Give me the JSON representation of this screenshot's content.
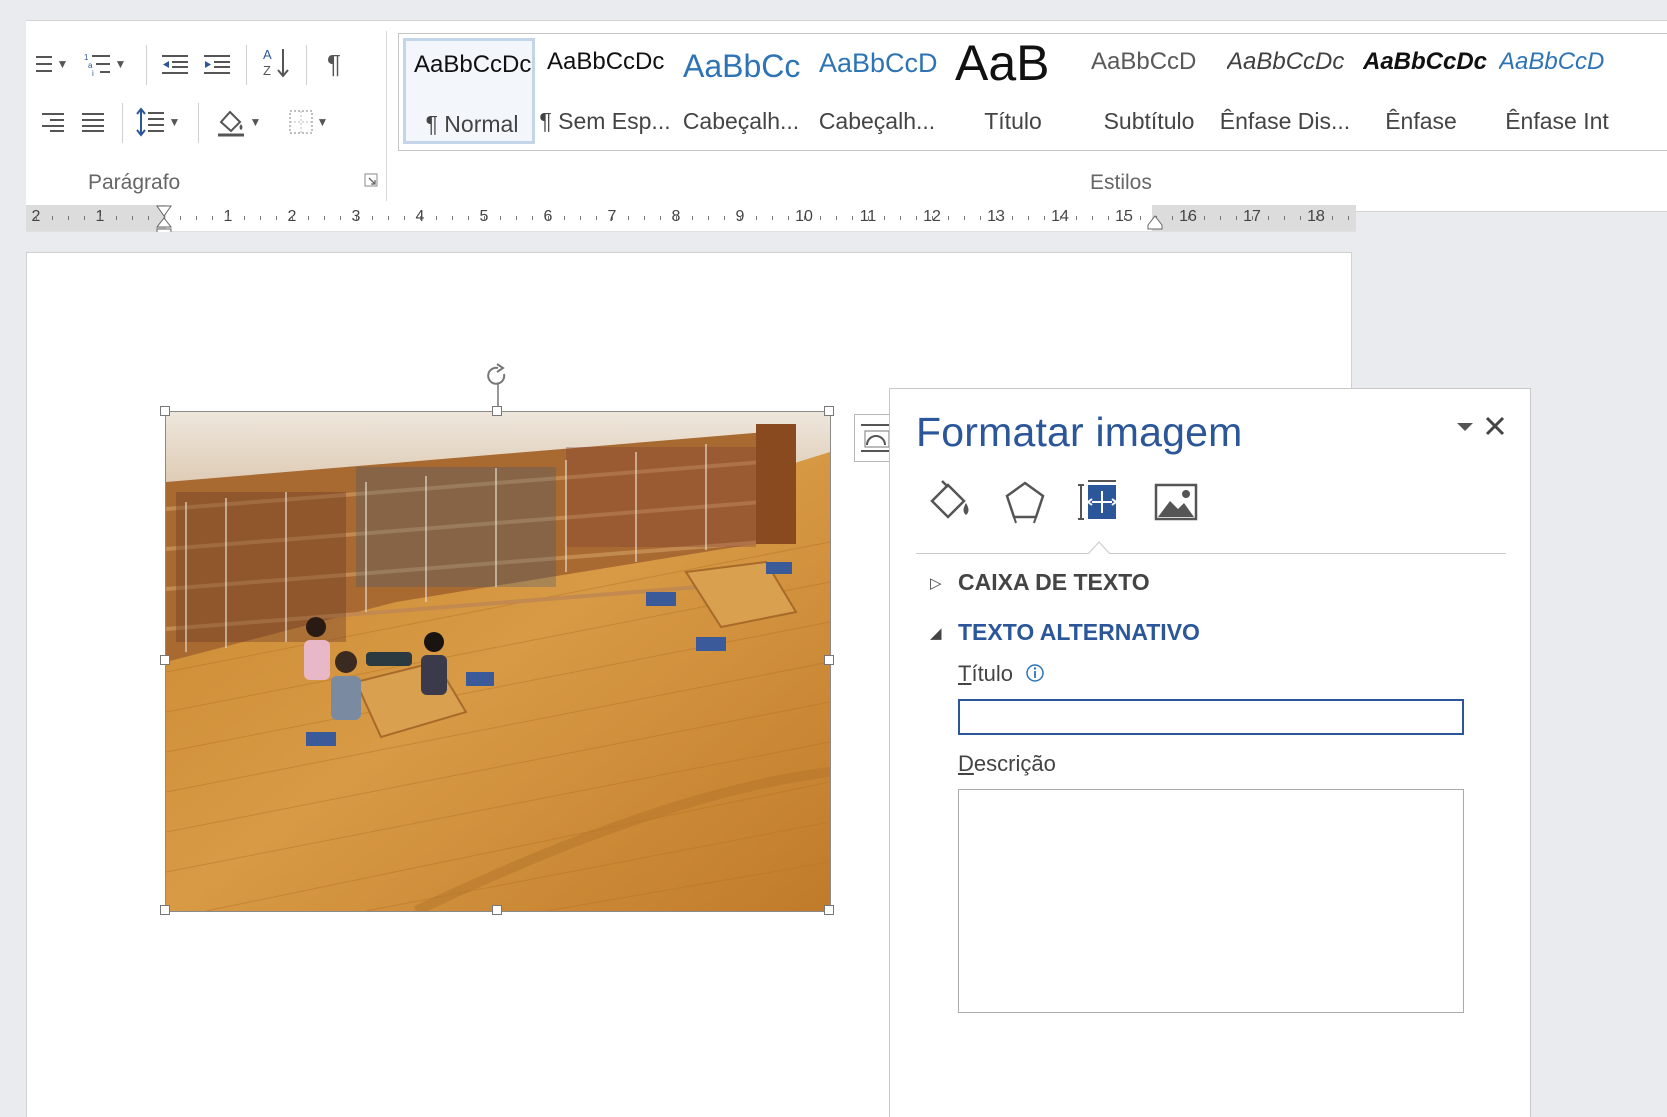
{
  "ribbon": {
    "paragraph_group_label": "Parágrafo",
    "styles_group_label": "Estilos",
    "styles": [
      {
        "preview": "AaBbCcDc",
        "name": "¶ Normal",
        "color": "#111111",
        "italic": false,
        "bold": false,
        "size": 24,
        "selected": true
      },
      {
        "preview": "AaBbCcDc",
        "name": "¶ Sem Esp...",
        "color": "#111111",
        "italic": false,
        "bold": false,
        "size": 24,
        "selected": false
      },
      {
        "preview": "AaBbCc",
        "name": "Cabeçalh...",
        "color": "#2e74b5",
        "italic": false,
        "bold": false,
        "size": 32,
        "selected": false
      },
      {
        "preview": "AaBbCcD",
        "name": "Cabeçalh...",
        "color": "#2e74b5",
        "italic": false,
        "bold": false,
        "size": 27,
        "selected": false
      },
      {
        "preview": "AaB",
        "name": "Título",
        "color": "#111111",
        "italic": false,
        "bold": false,
        "size": 50,
        "selected": false
      },
      {
        "preview": "AaBbCcD",
        "name": "Subtítulo",
        "color": "#595959",
        "italic": false,
        "bold": false,
        "size": 24,
        "selected": false
      },
      {
        "preview": "AaBbCcDc",
        "name": "Ênfase Dis...",
        "color": "#404040",
        "italic": true,
        "bold": false,
        "size": 24,
        "selected": false
      },
      {
        "preview": "AaBbCcDc",
        "name": "Ênfase",
        "color": "#111111",
        "italic": true,
        "bold": true,
        "size": 24,
        "selected": false
      },
      {
        "preview": "AaBbCcD",
        "name": "Ênfase Int",
        "color": "#2e74b5",
        "italic": true,
        "bold": false,
        "size": 24,
        "selected": false
      }
    ]
  },
  "ruler": {
    "labels": [
      "2",
      "1",
      "1",
      "2",
      "3",
      "4",
      "5",
      "6",
      "7",
      "8",
      "9",
      "10",
      "11",
      "12",
      "13",
      "14",
      "15",
      "16",
      "17",
      "18"
    ]
  },
  "pane": {
    "title": "Formatar imagem",
    "tabs": [
      "fill-line-icon",
      "effects-icon",
      "layout-properties-icon",
      "picture-icon"
    ],
    "section_textbox": "CAIXA DE TEXTO",
    "section_alt_text": "TEXTO ALTERNATIVO",
    "title_label_first": "T",
    "title_label_rest": "ítulo",
    "title_value": "",
    "desc_label_first": "D",
    "desc_label_rest": "escrição",
    "desc_value": ""
  },
  "colors": {
    "accent": "#2b579a",
    "heading_blue": "#2e74b5"
  }
}
